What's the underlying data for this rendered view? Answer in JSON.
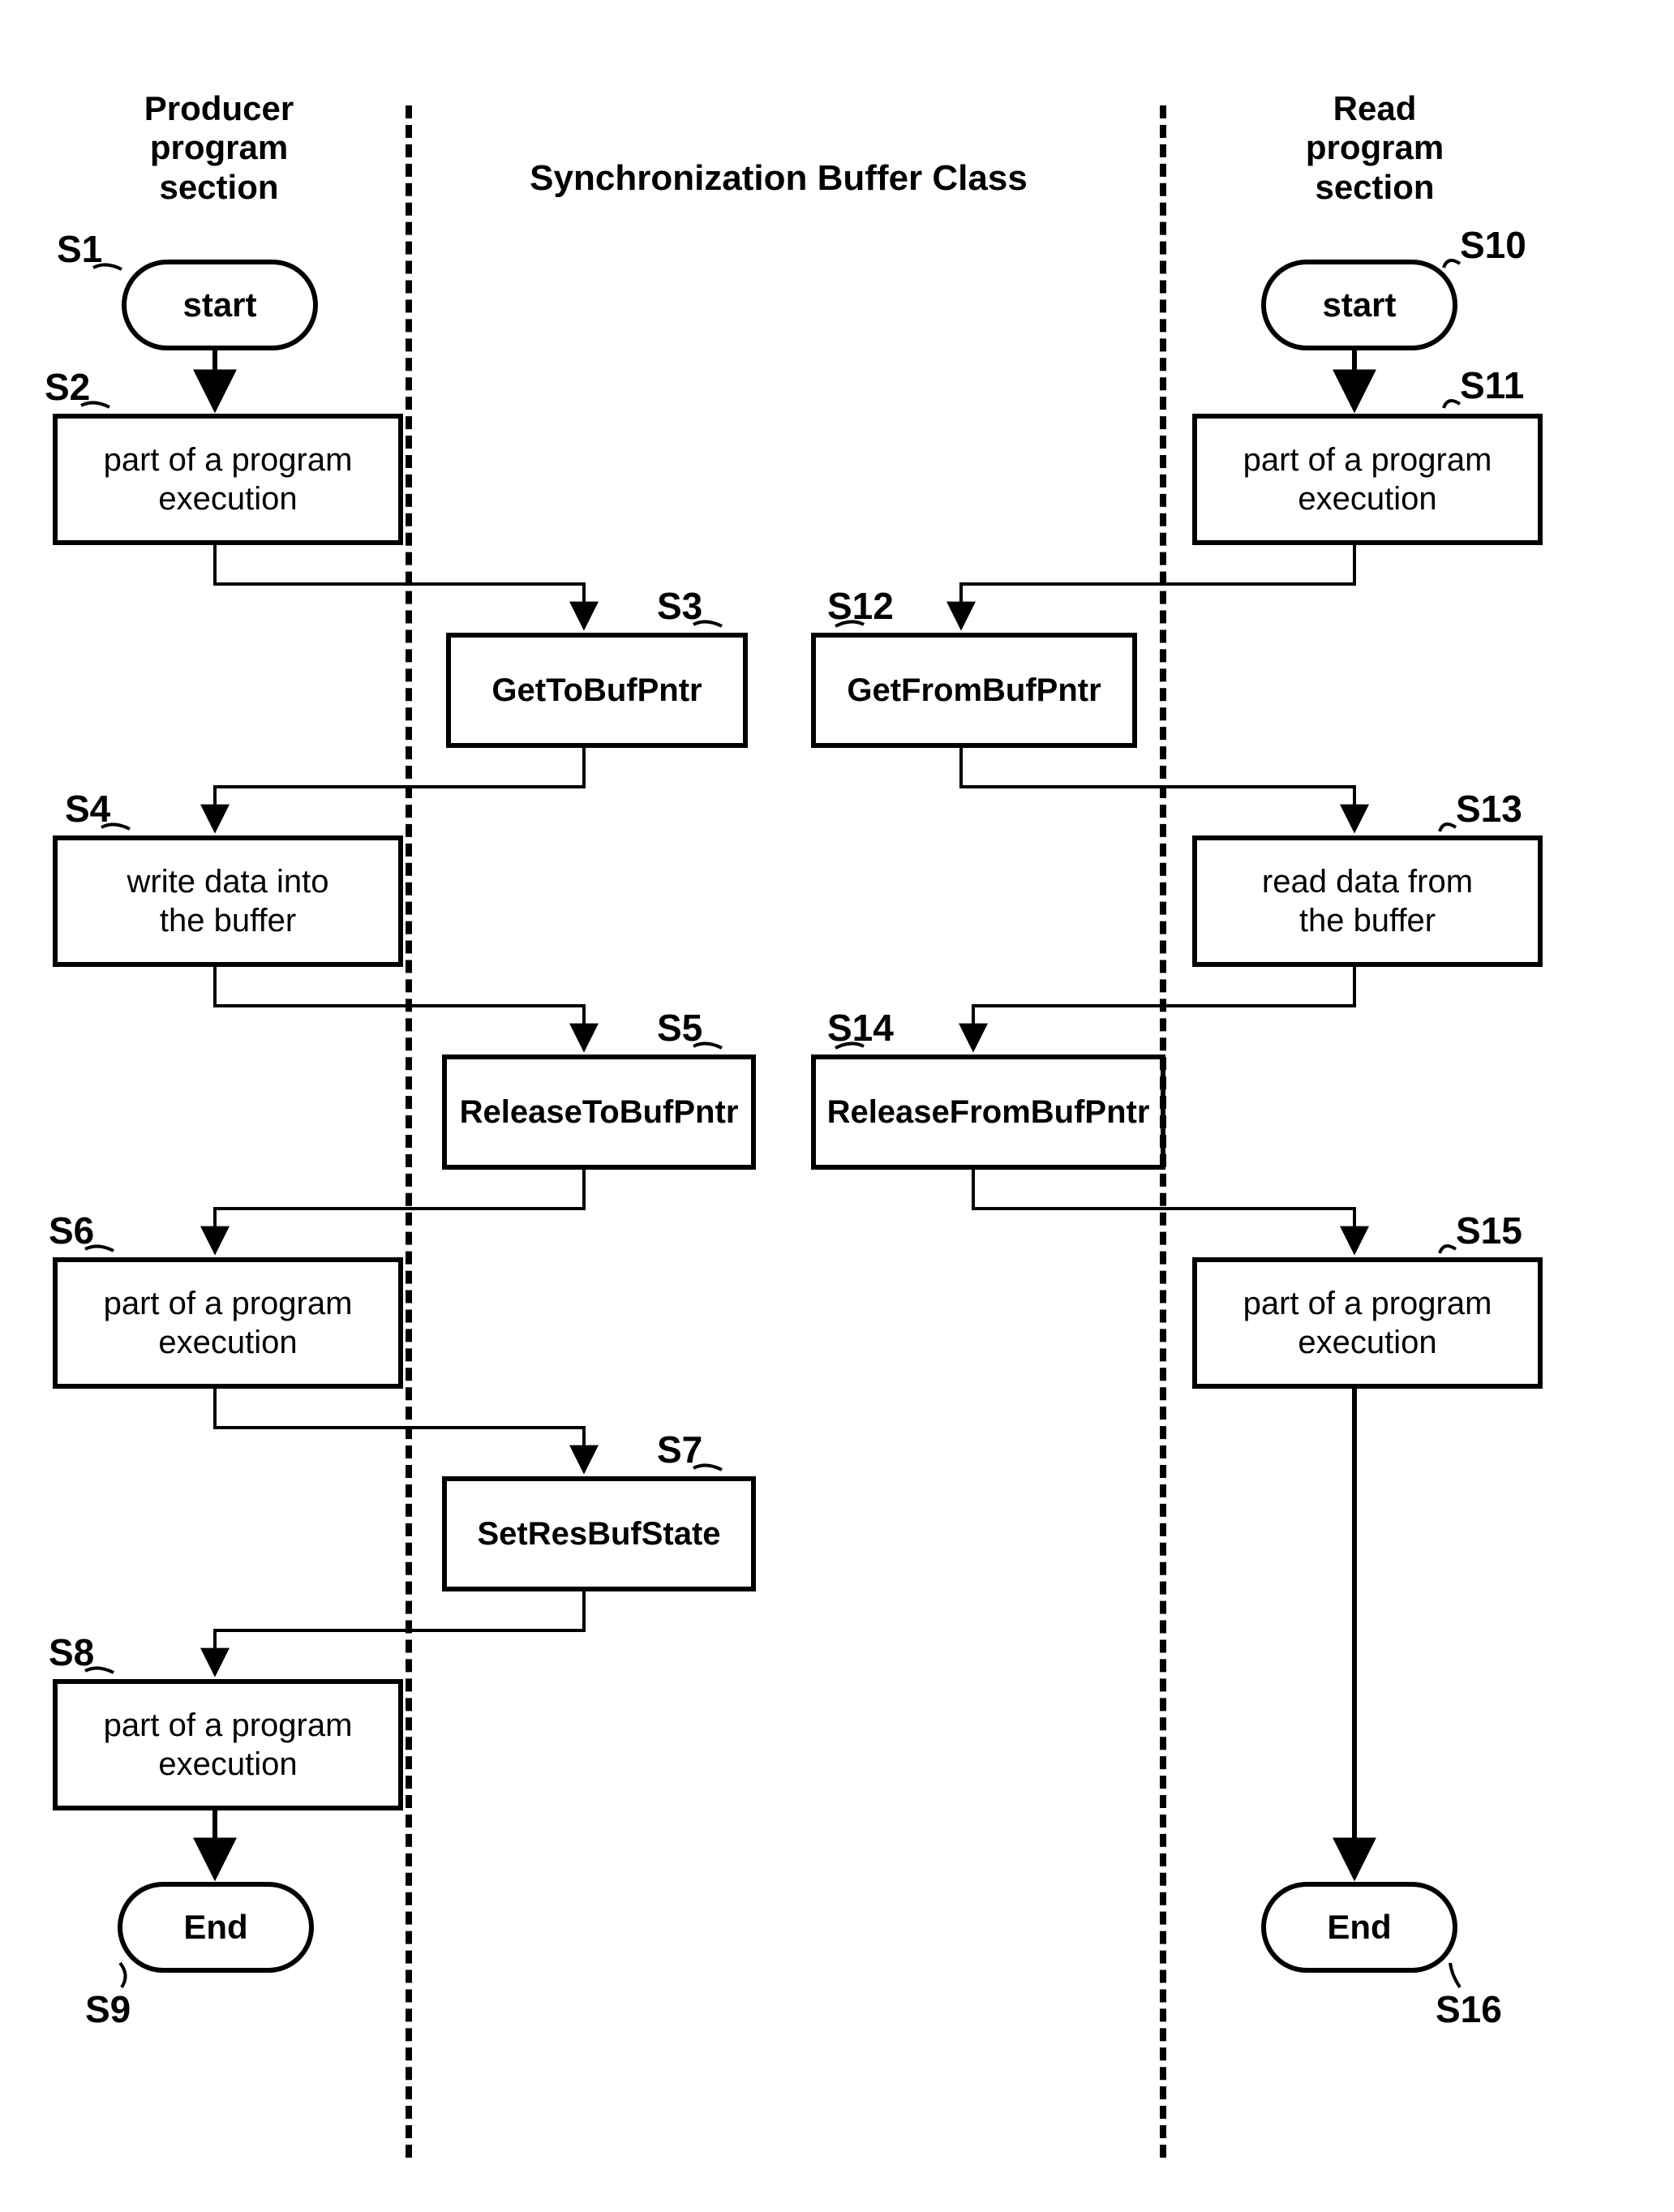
{
  "headers": {
    "producer": "Producer\nprogram\nsection",
    "middle": "Synchronization Buffer Class",
    "reader": "Read\nprogram\nsection"
  },
  "labels": {
    "S1": "S1",
    "S2": "S2",
    "S3": "S3",
    "S4": "S4",
    "S5": "S5",
    "S6": "S6",
    "S7": "S7",
    "S8": "S8",
    "S9": "S9",
    "S10": "S10",
    "S11": "S11",
    "S12": "S12",
    "S13": "S13",
    "S14": "S14",
    "S15": "S15",
    "S16": "S16"
  },
  "left": {
    "start": "start",
    "s2": "part of a program\nexecution",
    "s3": "GetToBufPntr",
    "s4": "write data into\nthe buffer",
    "s5": "ReleaseToBufPntr",
    "s6": "part of a program\nexecution",
    "s7": "SetResBufState",
    "s8": "part of a program\nexecution",
    "end": "End"
  },
  "right": {
    "start": "start",
    "s11": "part of a program\nexecution",
    "s12": "GetFromBufPntr",
    "s13": "read data from\nthe buffer",
    "s14": "ReleaseFromBufPntr",
    "s15": "part of a program\nexecution",
    "end": "End"
  }
}
